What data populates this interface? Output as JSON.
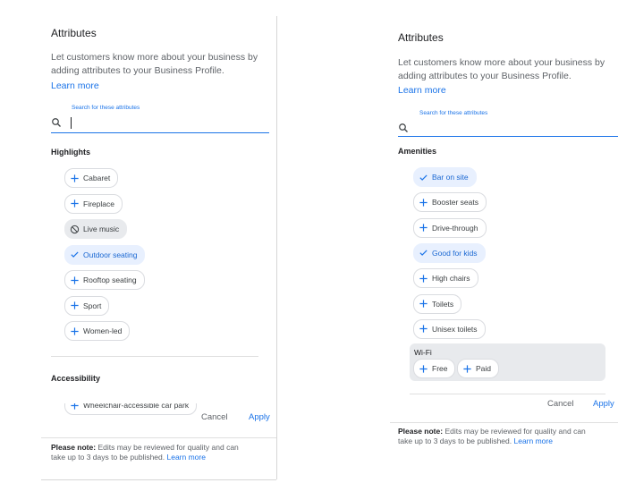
{
  "left": {
    "title": "Attributes",
    "desc_line1": "Let customers know more about your business by",
    "desc_line2": "adding attributes to your Business Profile.",
    "learn_more": "Learn more",
    "search_label": "Search for these attributes",
    "highlights_heading": "Highlights",
    "highlights": [
      {
        "label": "Cabaret",
        "state": "add"
      },
      {
        "label": "Fireplace",
        "state": "add"
      },
      {
        "label": "Live music",
        "state": "blocked"
      },
      {
        "label": "Outdoor seating",
        "state": "selected"
      },
      {
        "label": "Rooftop seating",
        "state": "add"
      },
      {
        "label": "Sport",
        "state": "add"
      },
      {
        "label": "Women-led",
        "state": "add"
      }
    ],
    "accessibility_heading": "Accessibility",
    "accessibility": [
      {
        "label": "Wheelchair-accessible car park",
        "state": "add"
      }
    ],
    "cancel": "Cancel",
    "apply": "Apply",
    "note_bold": "Please note:",
    "note_rest": " Edits may be reviewed for quality and can",
    "note_line2": "take up to 3 days to be published.",
    "note_learn": "Learn more"
  },
  "right": {
    "title": "Attributes",
    "desc_line1": "Let customers know more about your business by",
    "desc_line2": "adding attributes to your Business Profile.",
    "learn_more": "Learn more",
    "search_label": "Search for these attributes",
    "amenities_heading": "Amenities",
    "amenities": [
      {
        "label": "Bar on site",
        "state": "selected"
      },
      {
        "label": "Booster seats",
        "state": "add"
      },
      {
        "label": "Drive-through",
        "state": "add"
      },
      {
        "label": "Good for kids",
        "state": "selected"
      },
      {
        "label": "High chairs",
        "state": "add"
      },
      {
        "label": "Toilets",
        "state": "add"
      },
      {
        "label": "Unisex toilets",
        "state": "add"
      }
    ],
    "wifi_label": "Wi-Fi",
    "wifi_options": [
      {
        "label": "Free",
        "state": "add"
      },
      {
        "label": "Paid",
        "state": "add"
      }
    ],
    "cancel": "Cancel",
    "apply": "Apply",
    "note_bold": "Please note:",
    "note_rest": " Edits may be reviewed for quality and can",
    "note_line2": "take up to 3 days to be published.",
    "note_learn": "Learn more"
  },
  "colors": {
    "accent": "#1a73e8",
    "selected_bg": "#e8f0fe",
    "blocked_bg": "#e8eaed"
  }
}
